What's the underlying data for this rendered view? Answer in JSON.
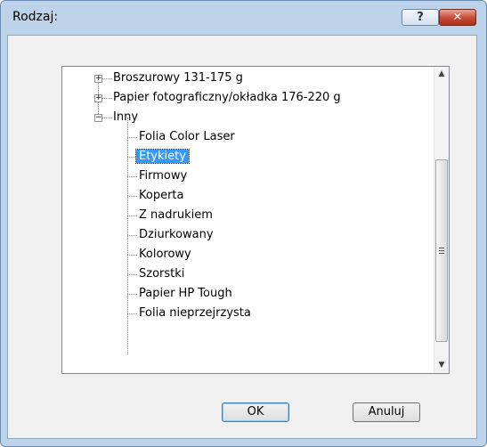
{
  "dialog": {
    "title": "Rodzaj:",
    "help_label": "?",
    "close_label": "✕"
  },
  "tree": {
    "collapsed_marker": "+",
    "expanded_marker": "−",
    "top_items": [
      {
        "label": "Broszurowy 131-175 g",
        "state": "collapsed"
      },
      {
        "label": "Papier fotograficzny/okładka 176-220 g",
        "state": "collapsed"
      },
      {
        "label": "Inny",
        "state": "expanded"
      }
    ],
    "children": [
      {
        "label": "Folia Color Laser"
      },
      {
        "label": "Etykiety",
        "selected": true
      },
      {
        "label": "Firmowy"
      },
      {
        "label": "Koperta"
      },
      {
        "label": "Z nadrukiem"
      },
      {
        "label": "Dziurkowany"
      },
      {
        "label": "Kolorowy"
      },
      {
        "label": "Szorstki"
      },
      {
        "label": "Papier HP Tough"
      },
      {
        "label": "Folia nieprzejrzysta"
      }
    ]
  },
  "scrollbar": {
    "up_arrow": "▲",
    "down_arrow": "▼"
  },
  "buttons": {
    "ok_label": "OK",
    "cancel_label": "Anuluj"
  },
  "colors": {
    "selection": "#3399ff",
    "frame": "#bcd3ea",
    "close_button": "#c7513b"
  }
}
